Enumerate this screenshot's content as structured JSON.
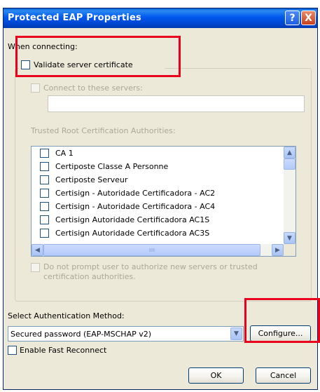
{
  "window": {
    "title": "Protected EAP Properties",
    "help_glyph": "?",
    "close_glyph": "X"
  },
  "connecting": {
    "label": "When connecting:",
    "validate_cert": {
      "label": "Validate server certificate",
      "checked": false
    },
    "connect_servers": {
      "label": "Connect to these servers:",
      "checked": false,
      "enabled": false,
      "value": ""
    }
  },
  "trusted_roots": {
    "label": "Trusted Root Certification Authorities:",
    "items": [
      {
        "label": "CA 1",
        "checked": false
      },
      {
        "label": "Certiposte Classe A Personne",
        "checked": false
      },
      {
        "label": "Certiposte Serveur",
        "checked": false
      },
      {
        "label": "Certisign - Autoridade Certificadora - AC2",
        "checked": false
      },
      {
        "label": "Certisign - Autoridade Certificadora - AC4",
        "checked": false
      },
      {
        "label": "Certisign Autoridade Certificadora AC1S",
        "checked": false
      },
      {
        "label": "Certisign Autoridade Certificadora AC3S",
        "checked": false
      }
    ],
    "scroll_up": "▲",
    "scroll_down": "▼",
    "scroll_left": "◀",
    "scroll_right": "▶",
    "hthumb_grip": "IIII"
  },
  "no_prompt": {
    "line1": "Do not prompt user to authorize new servers or trusted",
    "line2": "certification authorities.",
    "checked": false,
    "enabled": false
  },
  "auth": {
    "label": "Select Authentication Method:",
    "method": "Secured password (EAP-MSCHAP v2)",
    "dropdown_glyph": "▼",
    "configure": "Configure..."
  },
  "fast_reconnect": {
    "label": "Enable Fast Reconnect",
    "checked": false
  },
  "buttons": {
    "ok": "OK",
    "cancel": "Cancel"
  },
  "highlight_color": "#e8001c"
}
